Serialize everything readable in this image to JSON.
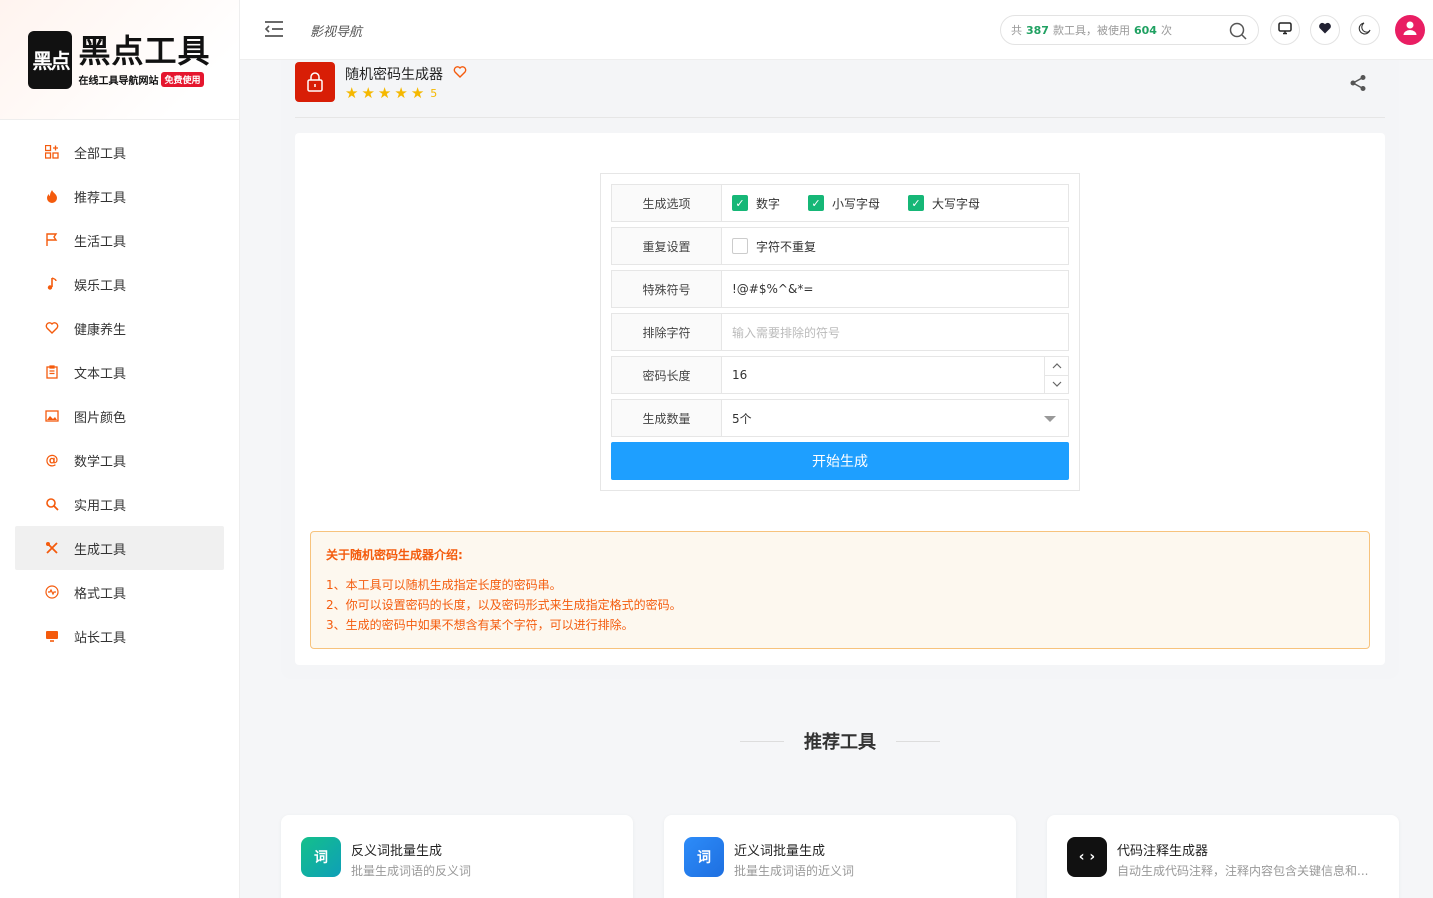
{
  "logo": {
    "mark": "黑点",
    "title": "黑点工具",
    "subtitle": "在线工具导航网站",
    "badge": "免费使用"
  },
  "sidebar": {
    "items": [
      {
        "label": "全部工具",
        "icon": "grid-icon"
      },
      {
        "label": "推荐工具",
        "icon": "fire-icon"
      },
      {
        "label": "生活工具",
        "icon": "flag-icon"
      },
      {
        "label": "娱乐工具",
        "icon": "music-icon"
      },
      {
        "label": "健康养生",
        "icon": "heart-icon"
      },
      {
        "label": "文本工具",
        "icon": "clipboard-icon"
      },
      {
        "label": "图片颜色",
        "icon": "image-icon"
      },
      {
        "label": "数学工具",
        "icon": "at-icon"
      },
      {
        "label": "实用工具",
        "icon": "search-icon"
      },
      {
        "label": "生成工具",
        "icon": "tools-icon"
      },
      {
        "label": "格式工具",
        "icon": "format-icon"
      },
      {
        "label": "站长工具",
        "icon": "monitor-icon"
      }
    ],
    "active_index": 9
  },
  "header": {
    "link": "影视导航",
    "search": {
      "prefix": "共",
      "tools": "387",
      "middle": "款工具，被使用",
      "uses": "604",
      "suffix": "次"
    }
  },
  "tool": {
    "title": "随机密码生成器",
    "rating": "5"
  },
  "form": {
    "options_label": "生成选项",
    "options": [
      {
        "label": "数字",
        "checked": true
      },
      {
        "label": "小写字母",
        "checked": true
      },
      {
        "label": "大写字母",
        "checked": true
      }
    ],
    "repeat_label": "重复设置",
    "repeat_option": "字符不重复",
    "special_label": "特殊符号",
    "special_value": "!@#$%^&*=",
    "exclude_label": "排除字符",
    "exclude_placeholder": "输入需要排除的符号",
    "length_label": "密码长度",
    "length_value": "16",
    "count_label": "生成数量",
    "count_value": "5个",
    "button": "开始生成"
  },
  "intro": {
    "title": "关于随机密码生成器介绍:",
    "lines": [
      "1、本工具可以随机生成指定长度的密码串。",
      "2、你可以设置密码的长度，以及密码形式来生成指定格式的密码。",
      "3、生成的密码中如果不想含有某个字符，可以进行排除。"
    ]
  },
  "recommended": {
    "title": "推荐工具",
    "cards": [
      {
        "title": "反义词批量生成",
        "desc": "批量生成词语的反义词",
        "icon_text": "词",
        "color": "#12b886"
      },
      {
        "title": "近义词批量生成",
        "desc": "批量生成词语的近义词",
        "icon_text": "词",
        "color": "#2d7ff9"
      },
      {
        "title": "代码注释生成器",
        "desc": "自动生成代码注释，注释内容包含关键信息和...",
        "icon_text": "‹ ›",
        "color": "#111111"
      }
    ]
  }
}
